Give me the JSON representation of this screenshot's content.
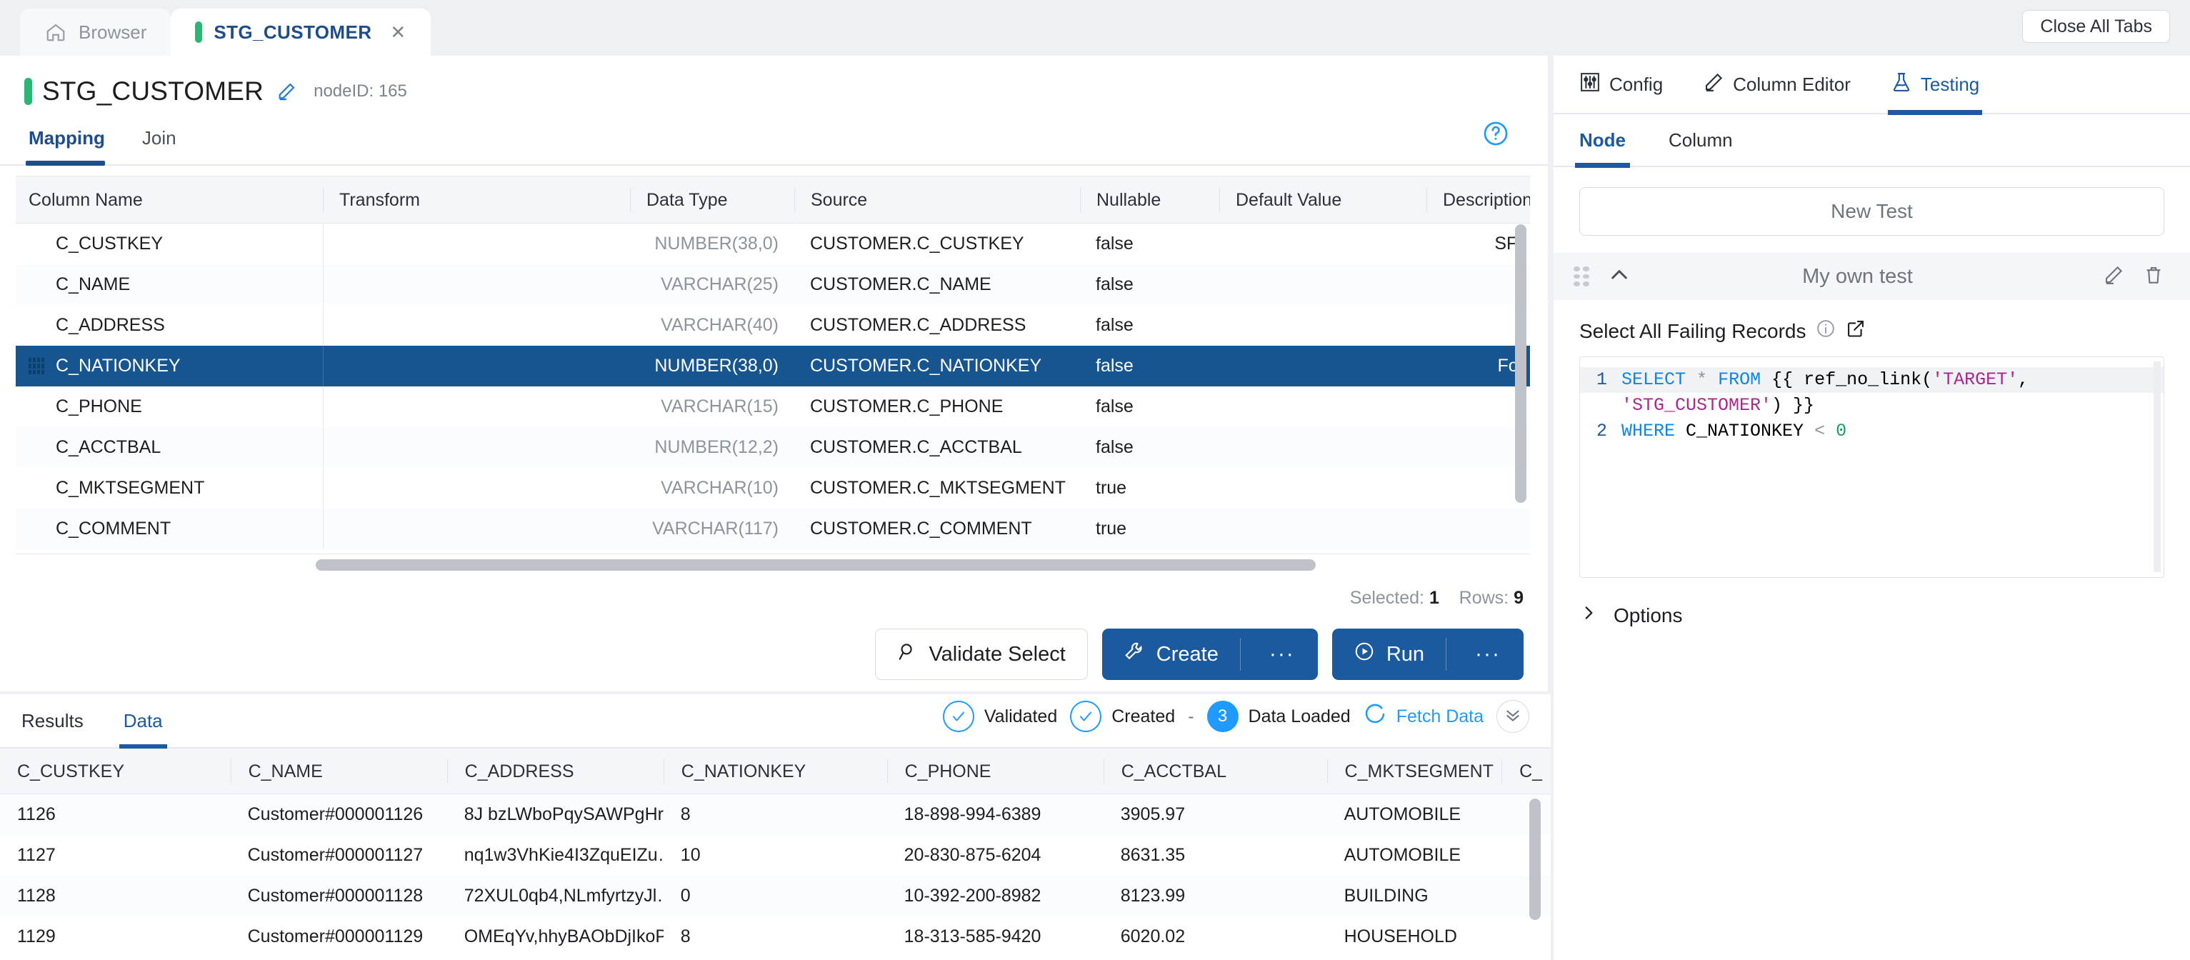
{
  "tabbar": {
    "browser_tab": "Browser",
    "browser_icon": "home-icon",
    "active_tab": "STG_CUSTOMER",
    "close_tab_glyph": "✕",
    "close_all_label": "Close All Tabs",
    "accent_green": "#2bb673"
  },
  "header": {
    "title": "STG_CUSTOMER",
    "edit_icon": "pencil-icon",
    "node_id": "nodeID: 165",
    "help_icon": "question-circle-icon"
  },
  "main_tabs": [
    {
      "label": "Mapping",
      "active": true
    },
    {
      "label": "Join",
      "active": false
    }
  ],
  "mapping_grid": {
    "columns": [
      "Column Name",
      "Transform",
      "Data Type",
      "Source",
      "Nullable",
      "Default Value",
      "Description"
    ],
    "rows": [
      {
        "name": "C_CUSTKEY",
        "transform": "",
        "dtype": "NUMBER(38,0)",
        "source": "CUSTOMER.C_CUSTKEY",
        "nullable": "false",
        "default": "",
        "desc": "SF*",
        "selected": false
      },
      {
        "name": "C_NAME",
        "transform": "",
        "dtype": "VARCHAR(25)",
        "source": "CUSTOMER.C_NAME",
        "nullable": "false",
        "default": "",
        "desc": "",
        "selected": false
      },
      {
        "name": "C_ADDRESS",
        "transform": "",
        "dtype": "VARCHAR(40)",
        "source": "CUSTOMER.C_ADDRESS",
        "nullable": "false",
        "default": "",
        "desc": "",
        "selected": false
      },
      {
        "name": "C_NATIONKEY",
        "transform": "",
        "dtype": "NUMBER(38,0)",
        "source": "CUSTOMER.C_NATIONKEY",
        "nullable": "false",
        "default": "",
        "desc": "For",
        "selected": true
      },
      {
        "name": "C_PHONE",
        "transform": "",
        "dtype": "VARCHAR(15)",
        "source": "CUSTOMER.C_PHONE",
        "nullable": "false",
        "default": "",
        "desc": "",
        "selected": false
      },
      {
        "name": "C_ACCTBAL",
        "transform": "",
        "dtype": "NUMBER(12,2)",
        "source": "CUSTOMER.C_ACCTBAL",
        "nullable": "false",
        "default": "",
        "desc": "",
        "selected": false
      },
      {
        "name": "C_MKTSEGMENT",
        "transform": "",
        "dtype": "VARCHAR(10)",
        "source": "CUSTOMER.C_MKTSEGMENT",
        "nullable": "true",
        "default": "",
        "desc": "",
        "selected": false
      },
      {
        "name": "C_COMMENT",
        "transform": "",
        "dtype": "VARCHAR(117)",
        "source": "CUSTOMER.C_COMMENT",
        "nullable": "true",
        "default": "",
        "desc": "",
        "selected": false
      }
    ],
    "selected_label": "Selected:",
    "selected_count": "1",
    "rows_label": "Rows:",
    "rows_count": "9",
    "selected_row_color": "#16558f"
  },
  "actions": {
    "validate_label": "Validate Select",
    "validate_icon": "magnifier-icon",
    "create_label": "Create",
    "create_icon": "wrench-icon",
    "create_more": "···",
    "run_label": "Run",
    "run_icon": "play-circle-icon",
    "run_more": "···",
    "primary_color": "#1b5a9e"
  },
  "right_panel": {
    "tabs": [
      {
        "label": "Config",
        "icon": "sliders-icon",
        "active": false
      },
      {
        "label": "Column Editor",
        "icon": "pencil-icon",
        "active": false
      },
      {
        "label": "Testing",
        "icon": "flask-icon",
        "active": true
      }
    ],
    "subtabs": [
      {
        "label": "Node",
        "active": true
      },
      {
        "label": "Column",
        "active": false
      }
    ],
    "new_test_label": "New Test",
    "test": {
      "drag_handle": "drag-dots-icon",
      "collapse_icon": "chevron-up-icon",
      "name": "My own test",
      "edit_icon": "pencil-icon",
      "delete_icon": "trash-icon"
    },
    "select_failing_label": "Select All Failing Records",
    "info_icon": "info-circle-icon",
    "open_external_icon": "external-link-icon",
    "sql": {
      "line1_no": "1",
      "line2_no": "2",
      "line1_tokens": [
        {
          "t": "SELECT",
          "c": "kw"
        },
        {
          "t": " ",
          "c": "plain"
        },
        {
          "t": "*",
          "c": "op"
        },
        {
          "t": " ",
          "c": "plain"
        },
        {
          "t": "FROM",
          "c": "kw"
        },
        {
          "t": " {{ ref_no_link(",
          "c": "plain"
        },
        {
          "t": "'TARGET'",
          "c": "str"
        },
        {
          "t": ",",
          "c": "plain"
        }
      ],
      "line1_cont_tokens": [
        {
          "t": "'STG_CUSTOMER'",
          "c": "str"
        },
        {
          "t": ") }}",
          "c": "plain"
        }
      ],
      "line2_tokens": [
        {
          "t": "WHERE",
          "c": "kw"
        },
        {
          "t": " C_NATIONKEY ",
          "c": "plain"
        },
        {
          "t": "<",
          "c": "op"
        },
        {
          "t": " ",
          "c": "plain"
        },
        {
          "t": "0",
          "c": "num"
        }
      ]
    },
    "options_label": "Options",
    "options_chevron": "chevron-right-icon"
  },
  "bottom_panel": {
    "tabs": [
      {
        "label": "Results",
        "active": false
      },
      {
        "label": "Data",
        "active": true
      }
    ],
    "status": {
      "validated_label": "Validated",
      "validated_icon": "check-circle-icon",
      "created_label": "Created",
      "created_icon": "check-circle-icon",
      "dash": "-",
      "loaded_count": "3",
      "loaded_label": "Data Loaded",
      "fetch_label": "Fetch Data",
      "fetch_icon": "refresh-icon",
      "collapse_icon": "chevron-double-down-icon",
      "accent": "#1f9bff"
    },
    "grid": {
      "columns": [
        "C_CUSTKEY",
        "C_NAME",
        "C_ADDRESS",
        "C_NATIONKEY",
        "C_PHONE",
        "C_ACCTBAL",
        "C_MKTSEGMENT",
        "C_"
      ],
      "rows": [
        [
          "1126",
          "Customer#000001126",
          "8J bzLWboPqySAWPgHr…",
          "8",
          "18-898-994-6389",
          "3905.97",
          "AUTOMOBILE",
          ""
        ],
        [
          "1127",
          "Customer#000001127",
          "nq1w3VhKie4I3ZquEIZu…",
          "10",
          "20-830-875-6204",
          "8631.35",
          "AUTOMOBILE",
          ""
        ],
        [
          "1128",
          "Customer#000001128",
          "72XUL0qb4,NLmfyrtzyJl…",
          "0",
          "10-392-200-8982",
          "8123.99",
          "BUILDING",
          ""
        ],
        [
          "1129",
          "Customer#000001129",
          "OMEqYv,hhyBAObDjIkoP…",
          "8",
          "18-313-585-9420",
          "6020.02",
          "HOUSEHOLD",
          ""
        ]
      ]
    }
  }
}
